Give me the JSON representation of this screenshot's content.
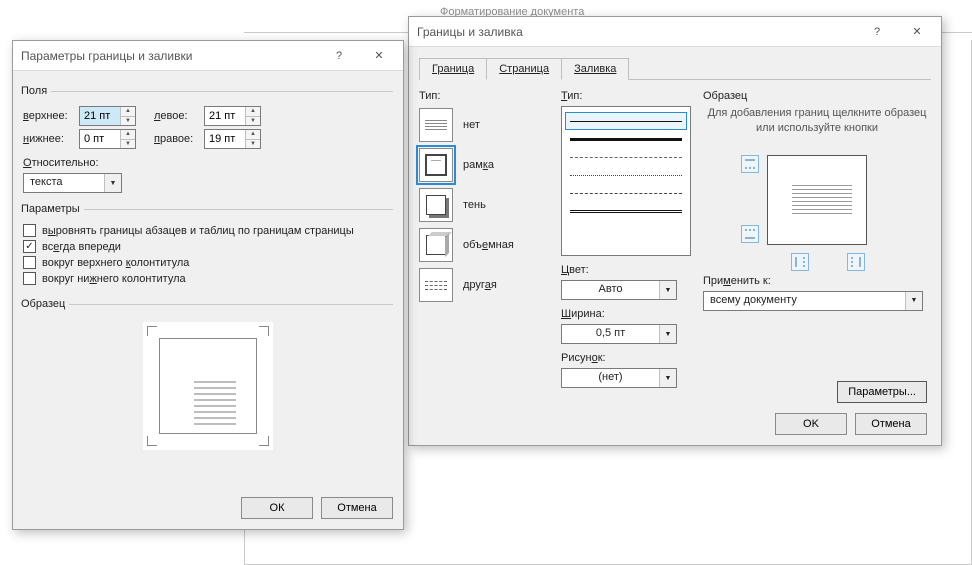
{
  "bg": {
    "title": "Форматирование документа"
  },
  "dlg1": {
    "title": "Параметры границы и заливки",
    "help": "?",
    "close": "✕",
    "margins": {
      "legend": "Поля",
      "top_label": "верхнее:",
      "top_value": "21 пт",
      "left_label": "левое:",
      "left_value": "21 пт",
      "bottom_label": "нижнее:",
      "bottom_value": "0 пт",
      "right_label": "правое:",
      "right_value": "19 пт"
    },
    "relative": {
      "label": "Относительно:",
      "value": "текста"
    },
    "params": {
      "legend": "Параметры",
      "chk1": "выровнять границы абзацев и таблиц по границам страницы",
      "chk2": "всегда впереди",
      "chk3": "вокруг верхнего колонтитула",
      "chk4": "вокруг нижнего колонтитула"
    },
    "sample_legend": "Образец",
    "ok": "ОК",
    "cancel": "Отмена"
  },
  "dlg2": {
    "title": "Границы и заливка",
    "help": "?",
    "close": "✕",
    "tabs": {
      "border": "Граница",
      "page": "Страница",
      "fill": "Заливка"
    },
    "type_label": "Тип:",
    "types": {
      "none": "нет",
      "box": "рамка",
      "shadow": "тень",
      "threeD": "объемная",
      "other": "другая"
    },
    "style_label": "Тип:",
    "color_label": "Цвет:",
    "color_value": "Авто",
    "width_label": "Ширина:",
    "width_value": "0,5 пт",
    "art_label": "Рисунок:",
    "art_value": "(нет)",
    "sample_label": "Образец",
    "sample_hint": "Для добавления границ щелкните образец или используйте кнопки",
    "apply_label": "Применить к:",
    "apply_value": "всему документу",
    "params_btn": "Параметры...",
    "ok": "OK",
    "cancel": "Отмена"
  }
}
